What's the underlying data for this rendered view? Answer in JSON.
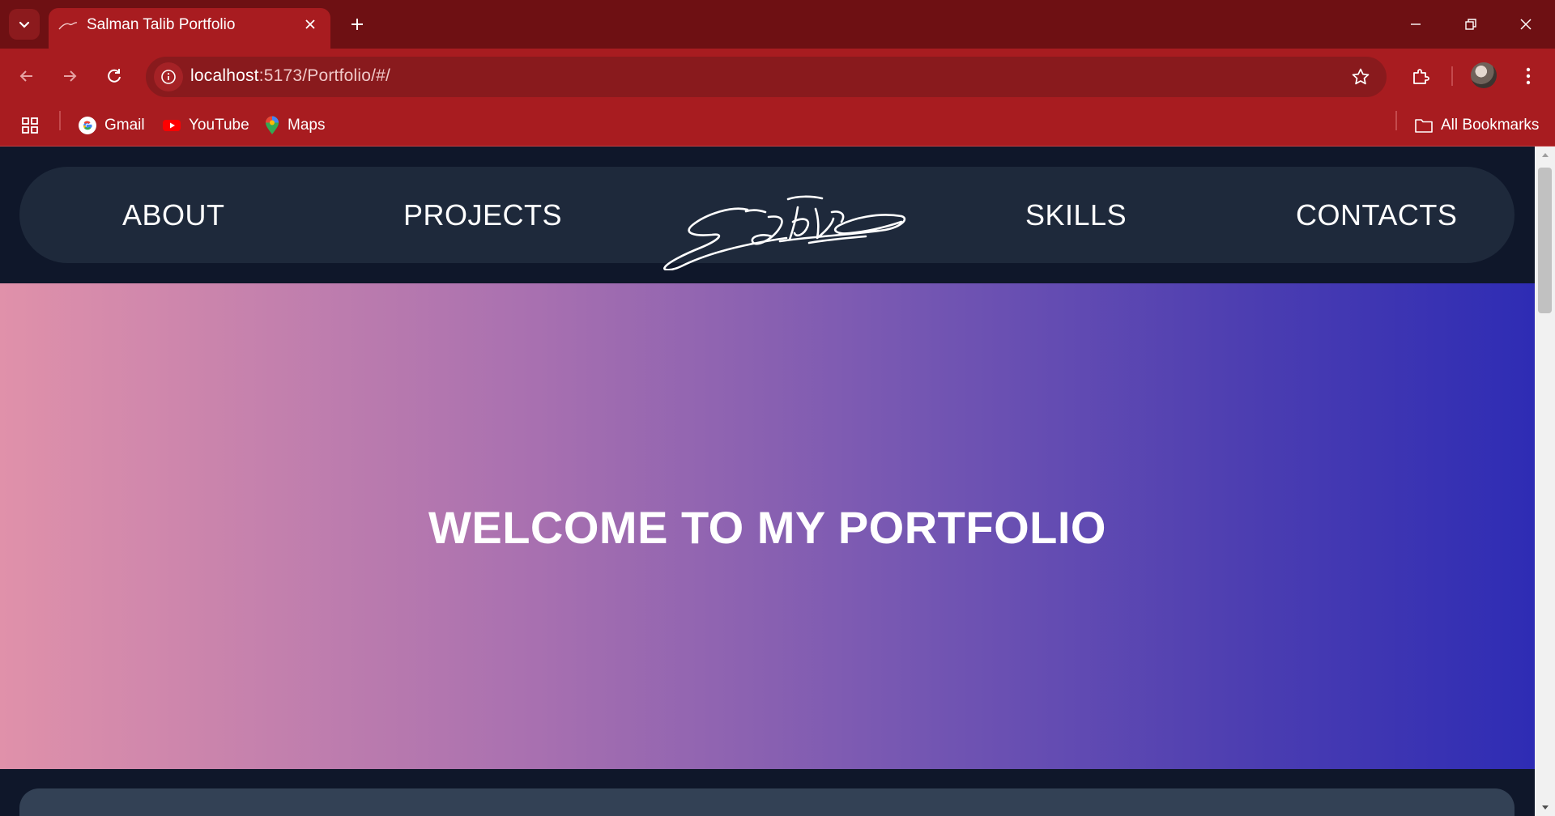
{
  "browser": {
    "tab": {
      "title": "Salman Talib Portfolio"
    },
    "address": {
      "host": "localhost",
      "path": ":5173/Portfolio/#/"
    },
    "bookmarks": [
      {
        "label": "Gmail",
        "icon": "google-icon"
      },
      {
        "label": "YouTube",
        "icon": "youtube-icon"
      },
      {
        "label": "Maps",
        "icon": "maps-icon"
      }
    ],
    "all_bookmarks": "All Bookmarks",
    "colors": {
      "tabstrip": "#6e1013",
      "toolbar": "#a81c20"
    }
  },
  "page": {
    "nav": {
      "items": [
        {
          "label": "ABOUT"
        },
        {
          "label": "PROJECTS"
        },
        {
          "label": "SKILLS"
        },
        {
          "label": "CONTACTS"
        }
      ],
      "logo": "signature-logo"
    },
    "hero": {
      "title": "WELCOME TO MY PORTFOLIO",
      "gradient": [
        "#e091aa",
        "#a870b0",
        "#7456b2",
        "#4b3db1",
        "#2e2cb4"
      ]
    },
    "colors": {
      "background": "#0f172a",
      "navbar": "#1e293b",
      "card": "#334155"
    }
  }
}
